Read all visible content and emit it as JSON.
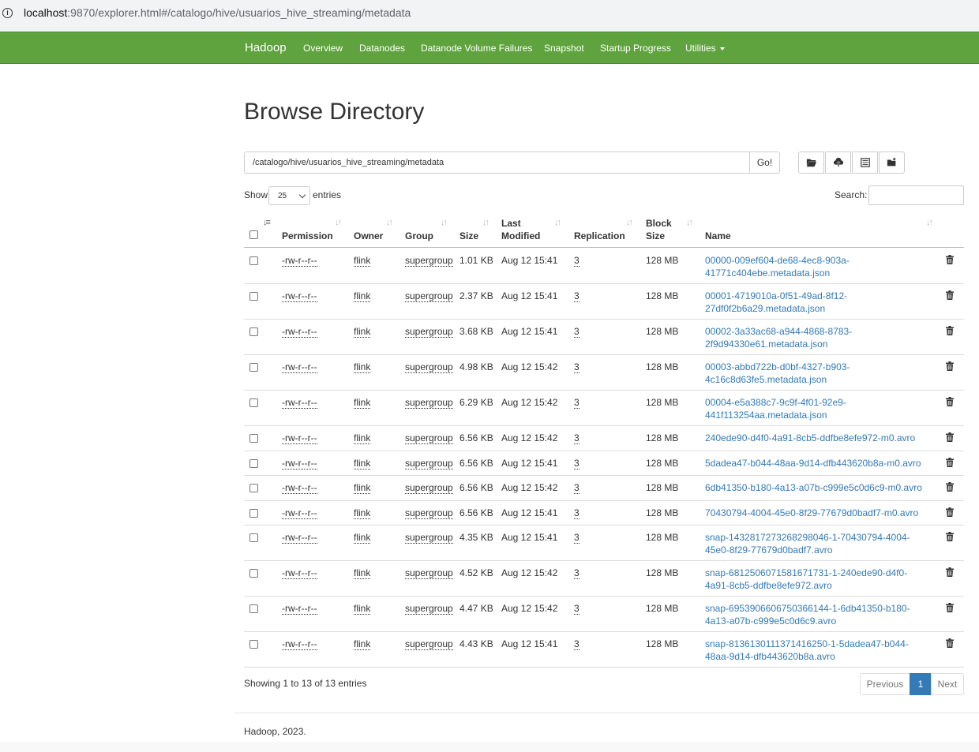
{
  "browser": {
    "url_host": "localhost",
    "url_rest": ":9870/explorer.html#/catalogo/hive/usuarios_hive_streaming/metadata"
  },
  "navbar": {
    "brand": "Hadoop",
    "links": [
      "Overview",
      "Datanodes",
      "Datanode Volume Failures",
      "Snapshot",
      "Startup Progress",
      "Utilities"
    ]
  },
  "page": {
    "title": "Browse Directory",
    "path_value": "/catalogo/hive/usuarios_hive_streaming/metadata",
    "go_label": "Go!",
    "toolbar_icons": [
      "folder-open-icon",
      "cloud-upload-icon",
      "list-icon",
      "create-folder-icon"
    ]
  },
  "controls": {
    "show_label": "Show",
    "page_size": "25",
    "entries_label": "entries",
    "search_label": "Search:"
  },
  "table": {
    "headers": {
      "permission": "Permission",
      "owner": "Owner",
      "group": "Group",
      "size": "Size",
      "last_modified_1": "Last",
      "last_modified_2": "Modified",
      "replication": "Replication",
      "block_size_1": "Block",
      "block_size_2": "Size",
      "name": "Name"
    },
    "rows": [
      {
        "permission": "-rw-r--r--",
        "owner": "flink",
        "group": "supergroup",
        "size": "1.01 KB",
        "modified": "Aug 12 15:41",
        "replication": "3",
        "block": "128 MB",
        "name": "00000-009ef604-de68-4ec8-903a-41771c404ebe.metadata.json"
      },
      {
        "permission": "-rw-r--r--",
        "owner": "flink",
        "group": "supergroup",
        "size": "2.37 KB",
        "modified": "Aug 12 15:41",
        "replication": "3",
        "block": "128 MB",
        "name": "00001-4719010a-0f51-49ad-8f12-27df0f2b6a29.metadata.json"
      },
      {
        "permission": "-rw-r--r--",
        "owner": "flink",
        "group": "supergroup",
        "size": "3.68 KB",
        "modified": "Aug 12 15:41",
        "replication": "3",
        "block": "128 MB",
        "name": "00002-3a33ac68-a944-4868-8783-2f9d94330e61.metadata.json"
      },
      {
        "permission": "-rw-r--r--",
        "owner": "flink",
        "group": "supergroup",
        "size": "4.98 KB",
        "modified": "Aug 12 15:42",
        "replication": "3",
        "block": "128 MB",
        "name": "00003-abbd722b-d0bf-4327-b903-4c16c8d63fe5.metadata.json"
      },
      {
        "permission": "-rw-r--r--",
        "owner": "flink",
        "group": "supergroup",
        "size": "6.29 KB",
        "modified": "Aug 12 15:42",
        "replication": "3",
        "block": "128 MB",
        "name": "00004-e5a388c7-9c9f-4f01-92e9-441f113254aa.metadata.json"
      },
      {
        "permission": "-rw-r--r--",
        "owner": "flink",
        "group": "supergroup",
        "size": "6.56 KB",
        "modified": "Aug 12 15:42",
        "replication": "3",
        "block": "128 MB",
        "name": "240ede90-d4f0-4a91-8cb5-ddfbe8efe972-m0.avro"
      },
      {
        "permission": "-rw-r--r--",
        "owner": "flink",
        "group": "supergroup",
        "size": "6.56 KB",
        "modified": "Aug 12 15:41",
        "replication": "3",
        "block": "128 MB",
        "name": "5dadea47-b044-48aa-9d14-dfb443620b8a-m0.avro"
      },
      {
        "permission": "-rw-r--r--",
        "owner": "flink",
        "group": "supergroup",
        "size": "6.56 KB",
        "modified": "Aug 12 15:42",
        "replication": "3",
        "block": "128 MB",
        "name": "6db41350-b180-4a13-a07b-c999e5c0d6c9-m0.avro"
      },
      {
        "permission": "-rw-r--r--",
        "owner": "flink",
        "group": "supergroup",
        "size": "6.56 KB",
        "modified": "Aug 12 15:41",
        "replication": "3",
        "block": "128 MB",
        "name": "70430794-4004-45e0-8f29-77679d0badf7-m0.avro"
      },
      {
        "permission": "-rw-r--r--",
        "owner": "flink",
        "group": "supergroup",
        "size": "4.35 KB",
        "modified": "Aug 12 15:41",
        "replication": "3",
        "block": "128 MB",
        "name": "snap-1432817273268298046-1-70430794-4004-45e0-8f29-77679d0badf7.avro"
      },
      {
        "permission": "-rw-r--r--",
        "owner": "flink",
        "group": "supergroup",
        "size": "4.52 KB",
        "modified": "Aug 12 15:42",
        "replication": "3",
        "block": "128 MB",
        "name": "snap-6812506071581671731-1-240ede90-d4f0-4a91-8cb5-ddfbe8efe972.avro"
      },
      {
        "permission": "-rw-r--r--",
        "owner": "flink",
        "group": "supergroup",
        "size": "4.47 KB",
        "modified": "Aug 12 15:42",
        "replication": "3",
        "block": "128 MB",
        "name": "snap-6953906606750366144-1-6db41350-b180-4a13-a07b-c999e5c0d6c9.avro"
      },
      {
        "permission": "-rw-r--r--",
        "owner": "flink",
        "group": "supergroup",
        "size": "4.43 KB",
        "modified": "Aug 12 15:41",
        "replication": "3",
        "block": "128 MB",
        "name": "snap-8136130111371416250-1-5dadea47-b044-48aa-9d14-dfb443620b8a.avro"
      }
    ]
  },
  "footer": {
    "info": "Showing 1 to 13 of 13 entries",
    "prev": "Previous",
    "page": "1",
    "next": "Next",
    "copyright": "Hadoop, 2023."
  }
}
